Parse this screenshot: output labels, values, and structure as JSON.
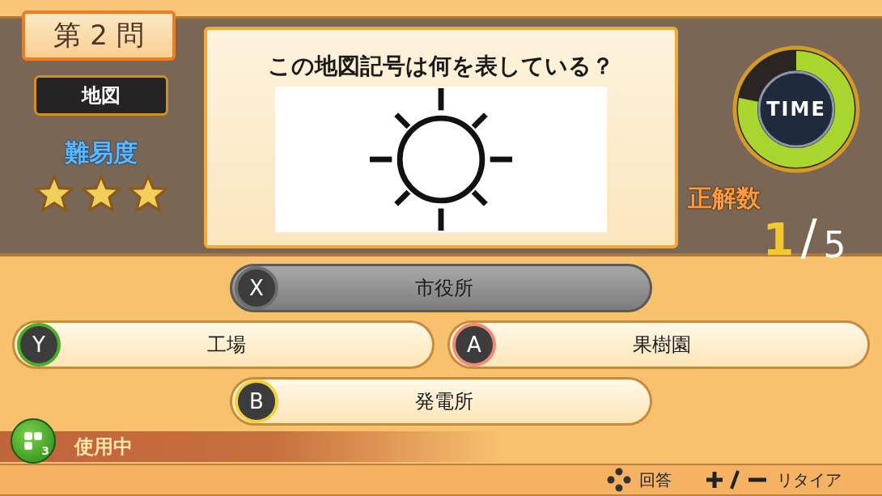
{
  "question_number": "第 2 問",
  "category": "地図",
  "difficulty": {
    "label": "難易度",
    "stars": 3
  },
  "question": "この地図記号は何を表している？",
  "timer": {
    "label": "TIME",
    "level": 0.78
  },
  "score": {
    "label": "正解数",
    "correct": "1",
    "separator": "/",
    "total": "5"
  },
  "answers": [
    {
      "key": "X",
      "label": "市役所",
      "color": "#6e6e6e",
      "disabled": true
    },
    {
      "key": "Y",
      "label": "工場",
      "color": "#4caf2a",
      "disabled": false
    },
    {
      "key": "A",
      "label": "果樹園",
      "color": "#f08a78",
      "disabled": false
    },
    {
      "key": "B",
      "label": "発電所",
      "color": "#f2d23c",
      "disabled": false
    }
  ],
  "hint": {
    "count": "3",
    "status": "使用中"
  },
  "footer": [
    {
      "kind": "dpad",
      "label": "回答"
    },
    {
      "kind": "plusminus",
      "label": "リタイア"
    }
  ]
}
